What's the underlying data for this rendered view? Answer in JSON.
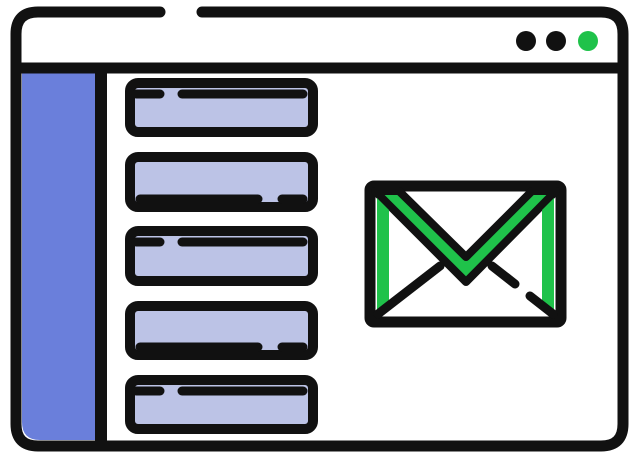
{
  "illustration": {
    "kind": "browser-window-with-email-icon",
    "colors": {
      "outline": "#111111",
      "window_bg": "#ffffff",
      "sidebar": "#6a7fdb",
      "list_item_fill": "#bcc3e6",
      "envelope_accent": "#1fc24a",
      "window_control_dark": "#111111",
      "window_control_active": "#1fc24a"
    },
    "window_controls": [
      {
        "name": "control-dot-1",
        "state": "dark"
      },
      {
        "name": "control-dot-2",
        "state": "dark"
      },
      {
        "name": "control-dot-3",
        "state": "active"
      }
    ],
    "list_items_count": 5,
    "icons": [
      "mail-envelope-icon"
    ]
  }
}
